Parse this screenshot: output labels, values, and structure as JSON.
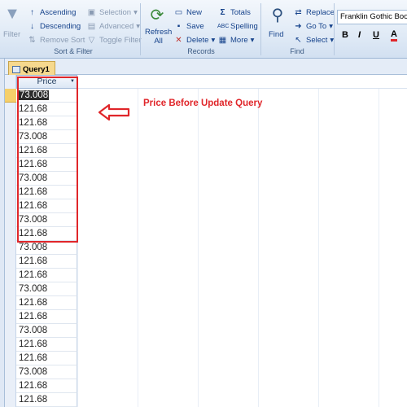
{
  "ribbon": {
    "sort_filter": {
      "filter_label": "Filter",
      "ascending_label": "Ascending",
      "descending_label": "Descending",
      "remove_sort_label": "Remove Sort",
      "selection_label": "Selection",
      "advanced_label": "Advanced",
      "toggle_filter_label": "Toggle Filter",
      "group_label": "Sort & Filter"
    },
    "records": {
      "refresh_label_1": "Refresh",
      "refresh_label_2": "All",
      "new_label": "New",
      "save_label": "Save",
      "delete_label": "Delete",
      "totals_label": "Totals",
      "spelling_label": "Spelling",
      "more_label": "More",
      "group_label": "Records"
    },
    "find": {
      "find_label": "Find",
      "replace_label": "Replace",
      "goto_label": "Go To",
      "select_label": "Select",
      "group_label": "Find"
    },
    "text_formatting": {
      "font_name": "Franklin Gothic Book",
      "bold": "B",
      "italic": "I",
      "underline": "U",
      "font_color": "A"
    }
  },
  "document": {
    "tab_label": "Query1",
    "column_header": "Price",
    "rows": [
      "73.008",
      "121.68",
      "121.68",
      "73.008",
      "121.68",
      "121.68",
      "73.008",
      "121.68",
      "121.68",
      "73.008",
      "121.68",
      "73.008",
      "121.68",
      "121.68",
      "73.008",
      "121.68",
      "121.68",
      "73.008",
      "121.68",
      "121.68",
      "73.008",
      "121.68",
      "121.68"
    ]
  },
  "annotation": {
    "text": "Price Before Update Query",
    "color": "#e0262a"
  }
}
